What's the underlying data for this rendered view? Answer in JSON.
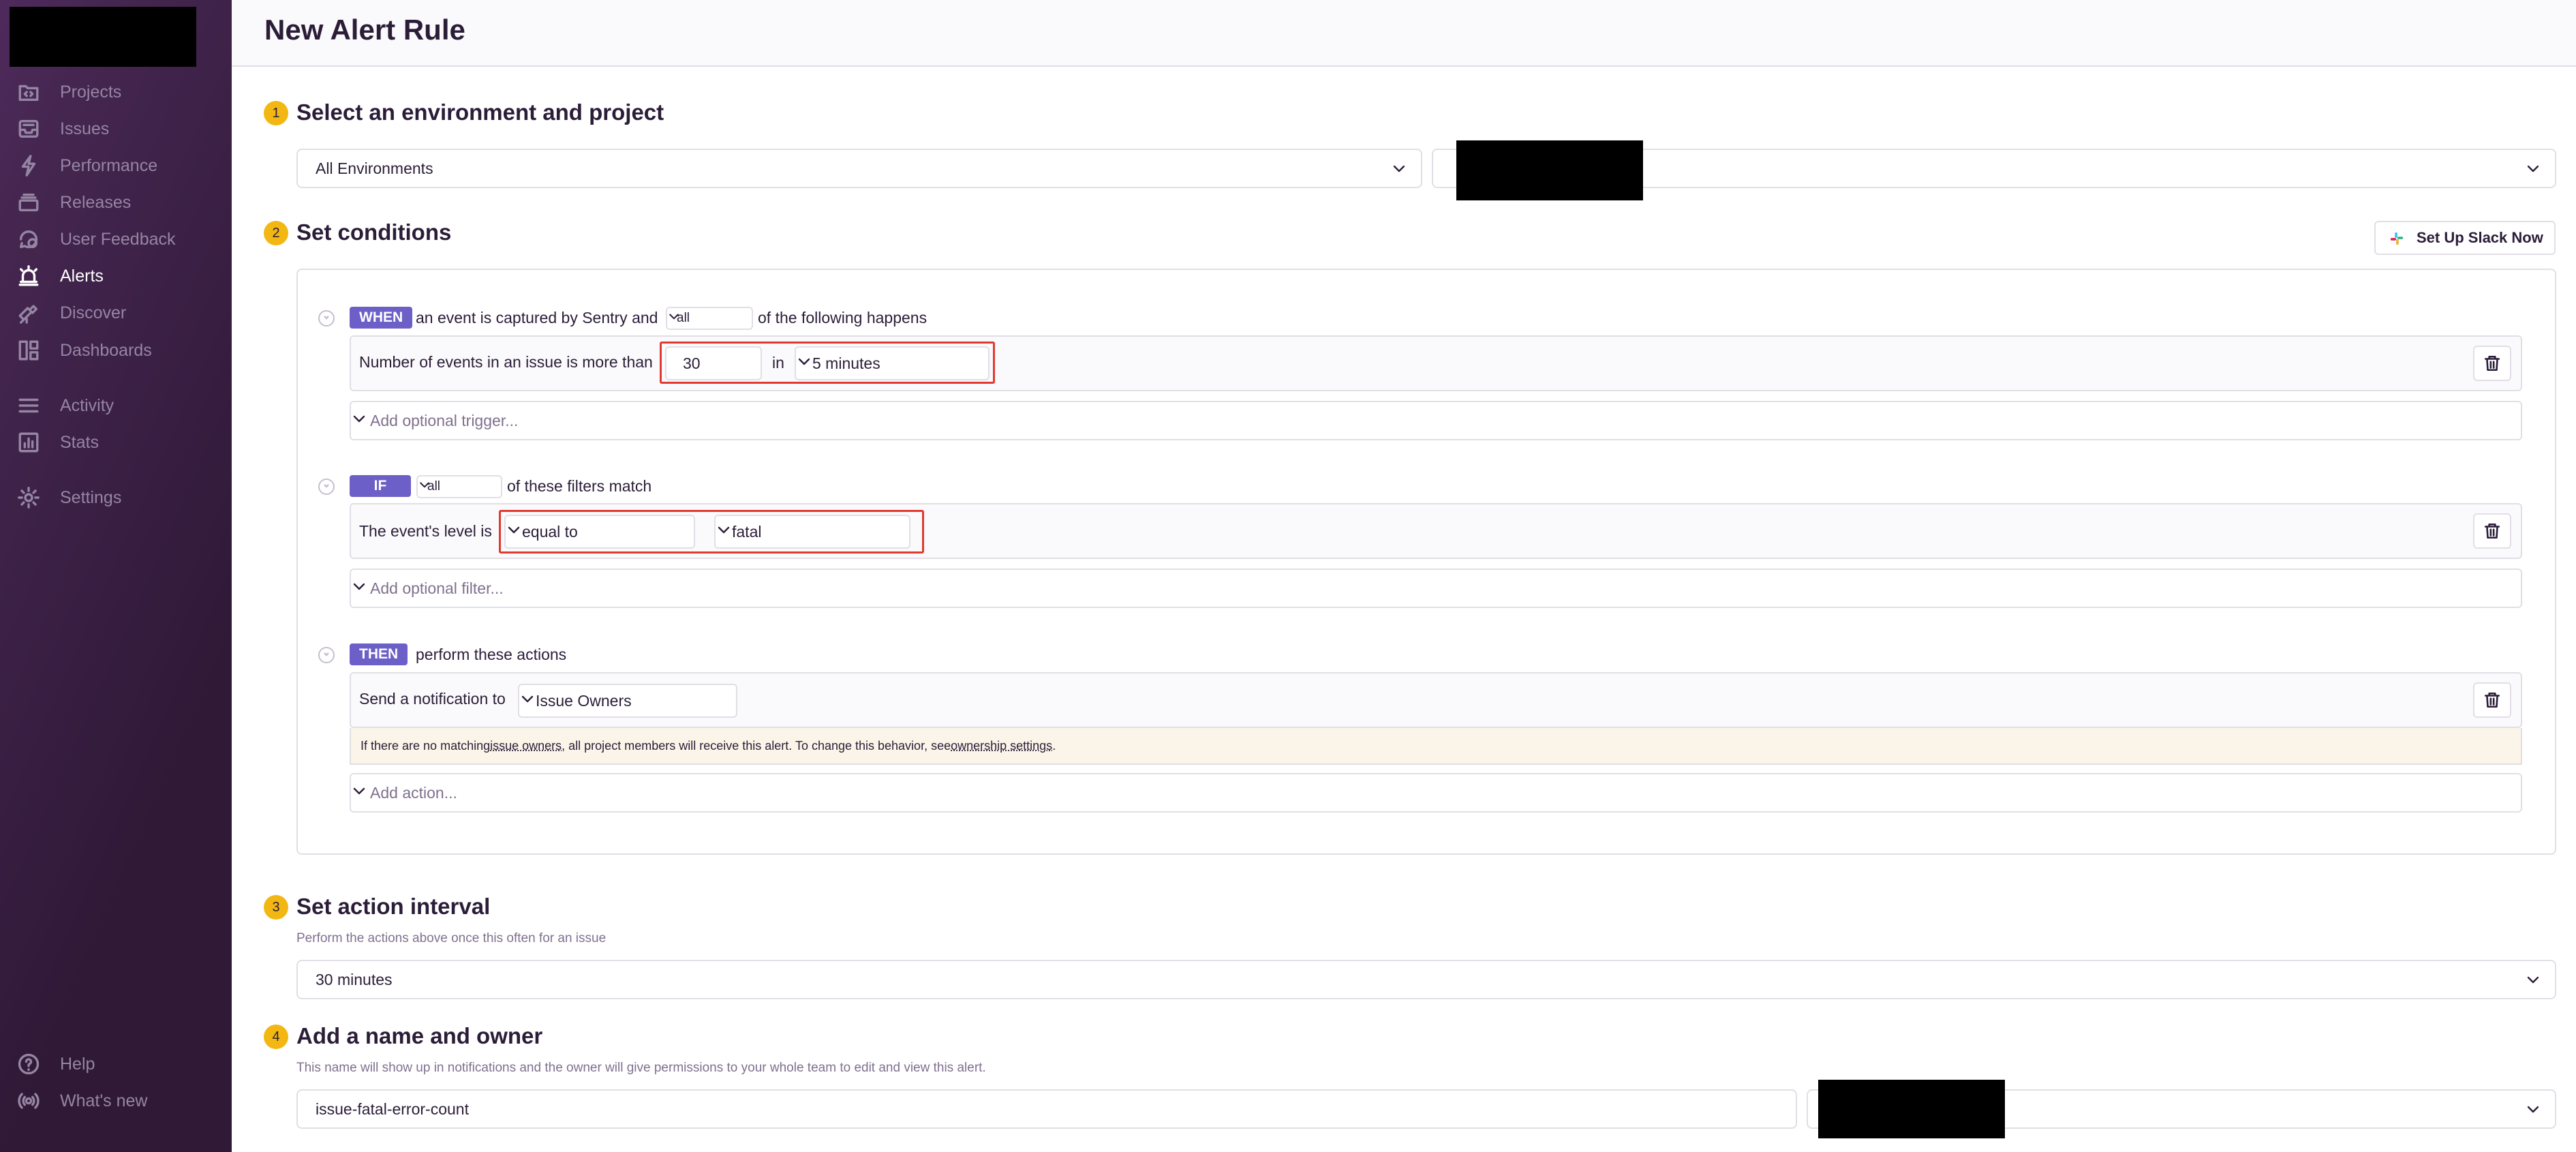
{
  "sidebar": {
    "items": [
      {
        "label": "Projects",
        "icon": "projects-icon"
      },
      {
        "label": "Issues",
        "icon": "issues-icon"
      },
      {
        "label": "Performance",
        "icon": "performance-icon"
      },
      {
        "label": "Releases",
        "icon": "releases-icon"
      },
      {
        "label": "User Feedback",
        "icon": "user-feedback-icon"
      },
      {
        "label": "Alerts",
        "icon": "alerts-icon",
        "active": true
      },
      {
        "label": "Discover",
        "icon": "discover-icon"
      },
      {
        "label": "Dashboards",
        "icon": "dashboards-icon"
      },
      {
        "label": "Activity",
        "icon": "activity-icon"
      },
      {
        "label": "Stats",
        "icon": "stats-icon"
      },
      {
        "label": "Settings",
        "icon": "settings-icon"
      }
    ],
    "footer": [
      {
        "label": "Help",
        "icon": "help-icon"
      },
      {
        "label": "What's new",
        "icon": "broadcast-icon"
      }
    ]
  },
  "header": {
    "title": "New Alert Rule"
  },
  "step1": {
    "number": "1",
    "title": "Select an environment and project",
    "environment_value": "All Environments"
  },
  "step2": {
    "number": "2",
    "title": "Set conditions",
    "slack_button_label": "Set Up Slack Now",
    "when": {
      "badge": "WHEN",
      "text_before": "an event is captured by Sentry and",
      "match_value": "all",
      "text_after": "of the following happens",
      "condition": {
        "label": "Number of events in an issue is more than",
        "value": "30",
        "in_label": "in",
        "interval": "5 minutes"
      },
      "add_placeholder": "Add optional trigger..."
    },
    "if": {
      "badge": "IF",
      "match_value": "all",
      "text_after": "of these filters match",
      "filter": {
        "label": "The event's level is",
        "comparison": "equal to",
        "level": "fatal"
      },
      "add_placeholder": "Add optional filter..."
    },
    "then": {
      "badge": "THEN",
      "text_after": "perform these actions",
      "action": {
        "label": "Send a notification to",
        "target": "Issue Owners"
      },
      "warning": {
        "part1": "If there are no matching ",
        "link1": "issue owners",
        "part2": ", all project members will receive this alert. To change this behavior, see ",
        "link2": "ownership settings",
        "part3": "."
      },
      "add_placeholder": "Add action..."
    }
  },
  "step3": {
    "number": "3",
    "title": "Set action interval",
    "help": "Perform the actions above once this often for an issue",
    "value": "30 minutes"
  },
  "step4": {
    "number": "4",
    "title": "Add a name and owner",
    "help": "This name will show up in notifications and the owner will give permissions to your whole team to edit and view this alert.",
    "name_value": "issue-fatal-error-count"
  }
}
